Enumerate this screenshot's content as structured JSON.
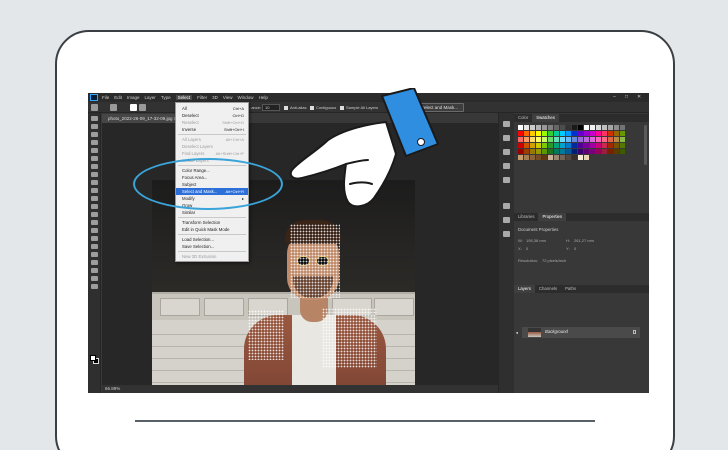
{
  "photoshop": {
    "menubar": {
      "items": [
        "File",
        "Edit",
        "Image",
        "Layer",
        "Type",
        "Select",
        "Filter",
        "3D",
        "View",
        "Window",
        "Help"
      ],
      "active_item": "Select"
    },
    "options_bar": {
      "opacity_label": "...ance:",
      "opacity_value": "10",
      "anti_alias_label": "Anti-alias",
      "contiguous_label": "Contiguous",
      "sample_all_layers_label": "Sample All Layers",
      "select_and_mask_button": "Select and Mask..."
    },
    "document": {
      "tab_title": "photo_2022-26-09_17-32-09.jpg @ 66.7% (RGB/8#)",
      "zoom_status": "66.89%"
    },
    "select_menu": {
      "items": [
        {
          "label": "All",
          "shortcut": "Ctrl+A",
          "disabled": false
        },
        {
          "label": "Deselect",
          "shortcut": "Ctrl+D",
          "disabled": false
        },
        {
          "label": "Reselect",
          "shortcut": "Shift+Ctrl+D",
          "disabled": true
        },
        {
          "label": "Inverse",
          "shortcut": "Shift+Ctrl+I",
          "disabled": false
        },
        {
          "label": "All Layers",
          "shortcut": "Alt+Ctrl+A",
          "disabled": true
        },
        {
          "label": "Deselect Layers",
          "shortcut": "",
          "disabled": true
        },
        {
          "label": "Find Layers",
          "shortcut": "Alt+Shift+Ctrl+F",
          "disabled": true
        },
        {
          "label": "Isolate Layers",
          "shortcut": "",
          "disabled": true
        },
        {
          "label": "Color Range...",
          "shortcut": "",
          "disabled": false
        },
        {
          "label": "Focus Area...",
          "shortcut": "",
          "disabled": false
        },
        {
          "label": "Subject",
          "shortcut": "",
          "disabled": false
        },
        {
          "label": "Select and Mask...",
          "shortcut": "Alt+Ctrl+R",
          "disabled": false,
          "highlighted": true
        },
        {
          "label": "Modify",
          "shortcut": "▸",
          "disabled": false
        },
        {
          "label": "Grow",
          "shortcut": "",
          "disabled": false
        },
        {
          "label": "Similar",
          "shortcut": "",
          "disabled": false
        },
        {
          "label": "Transform Selection",
          "shortcut": "",
          "disabled": false
        },
        {
          "label": "Edit in Quick Mask Mode",
          "shortcut": "",
          "disabled": false
        },
        {
          "label": "Load Selection...",
          "shortcut": "",
          "disabled": false
        },
        {
          "label": "Save Selection...",
          "shortcut": "",
          "disabled": false
        },
        {
          "label": "New 3D Extrusion",
          "shortcut": "",
          "disabled": true
        }
      ]
    },
    "color_panel": {
      "tabs": [
        "Color",
        "Swatches"
      ],
      "active_tab": "Swatches",
      "swatches": [
        "#ffffff",
        "#e6e6e6",
        "#cccccc",
        "#b3b3b3",
        "#999999",
        "#808080",
        "#666666",
        "#4d4d4d",
        "#333333",
        "#1a1a1a",
        "#000000",
        "#ffffff",
        "#f2f2f2",
        "#d9d9d9",
        "#bfbfbf",
        "#a6a6a6",
        "#8c8c8c",
        "#737373",
        "#ff0000",
        "#ff6600",
        "#ffcc00",
        "#ffff00",
        "#99ff00",
        "#33cc33",
        "#00cc99",
        "#00ccff",
        "#0099ff",
        "#0033cc",
        "#6600cc",
        "#9900cc",
        "#cc00cc",
        "#ff0099",
        "#ff3366",
        "#cc3300",
        "#996600",
        "#669900",
        "#ff6666",
        "#ff9966",
        "#ffdd66",
        "#ffff66",
        "#ccff66",
        "#66dd66",
        "#66ddbb",
        "#66ddff",
        "#66bbff",
        "#6688dd",
        "#9966dd",
        "#bb66dd",
        "#dd66dd",
        "#ff66bb",
        "#ff6688",
        "#dd6644",
        "#bb8844",
        "#88bb44",
        "#cc0000",
        "#cc5200",
        "#cca300",
        "#cccc00",
        "#7acc00",
        "#299a29",
        "#00a37a",
        "#00a3cc",
        "#007acc",
        "#002999",
        "#520099",
        "#7a0099",
        "#a300a3",
        "#cc007a",
        "#cc2952",
        "#a32900",
        "#7a5200",
        "#527a00",
        "#990000",
        "#993d00",
        "#997a00",
        "#999900",
        "#5c9900",
        "#1f731f",
        "#007a5c",
        "#007a99",
        "#005c99",
        "#001f73",
        "#3d0073",
        "#5c0073",
        "#7a007a",
        "#99005c",
        "#991f3d",
        "#7a1f00",
        "#5c3d00",
        "#3d5c00",
        "#c69c6d",
        "#a67c52",
        "#8c6239",
        "#754c24",
        "#603913",
        "#c7b299",
        "#998675",
        "#736357",
        "#534741",
        "#362f2d",
        "#f7ecd9",
        "#e8d5b5"
      ]
    },
    "properties_panel": {
      "tabs": [
        "Libraries",
        "Properties"
      ],
      "active_tab": "Properties",
      "title": "Document Properties",
      "w_label": "W:",
      "w_value": "195,38 mm",
      "h_label": "H:",
      "h_value": "261,27 mm",
      "x_label": "X:",
      "x_value": "0",
      "y_label": "Y:",
      "y_value": "0",
      "resolution_label": "Resolution:",
      "resolution_value": "72 pixels/inch"
    },
    "layers_panel": {
      "tabs": [
        "Layers",
        "Channels",
        "Paths"
      ],
      "active_tab": "Layers",
      "layers": [
        {
          "name": "Background",
          "visible": true,
          "locked": true
        }
      ]
    }
  }
}
